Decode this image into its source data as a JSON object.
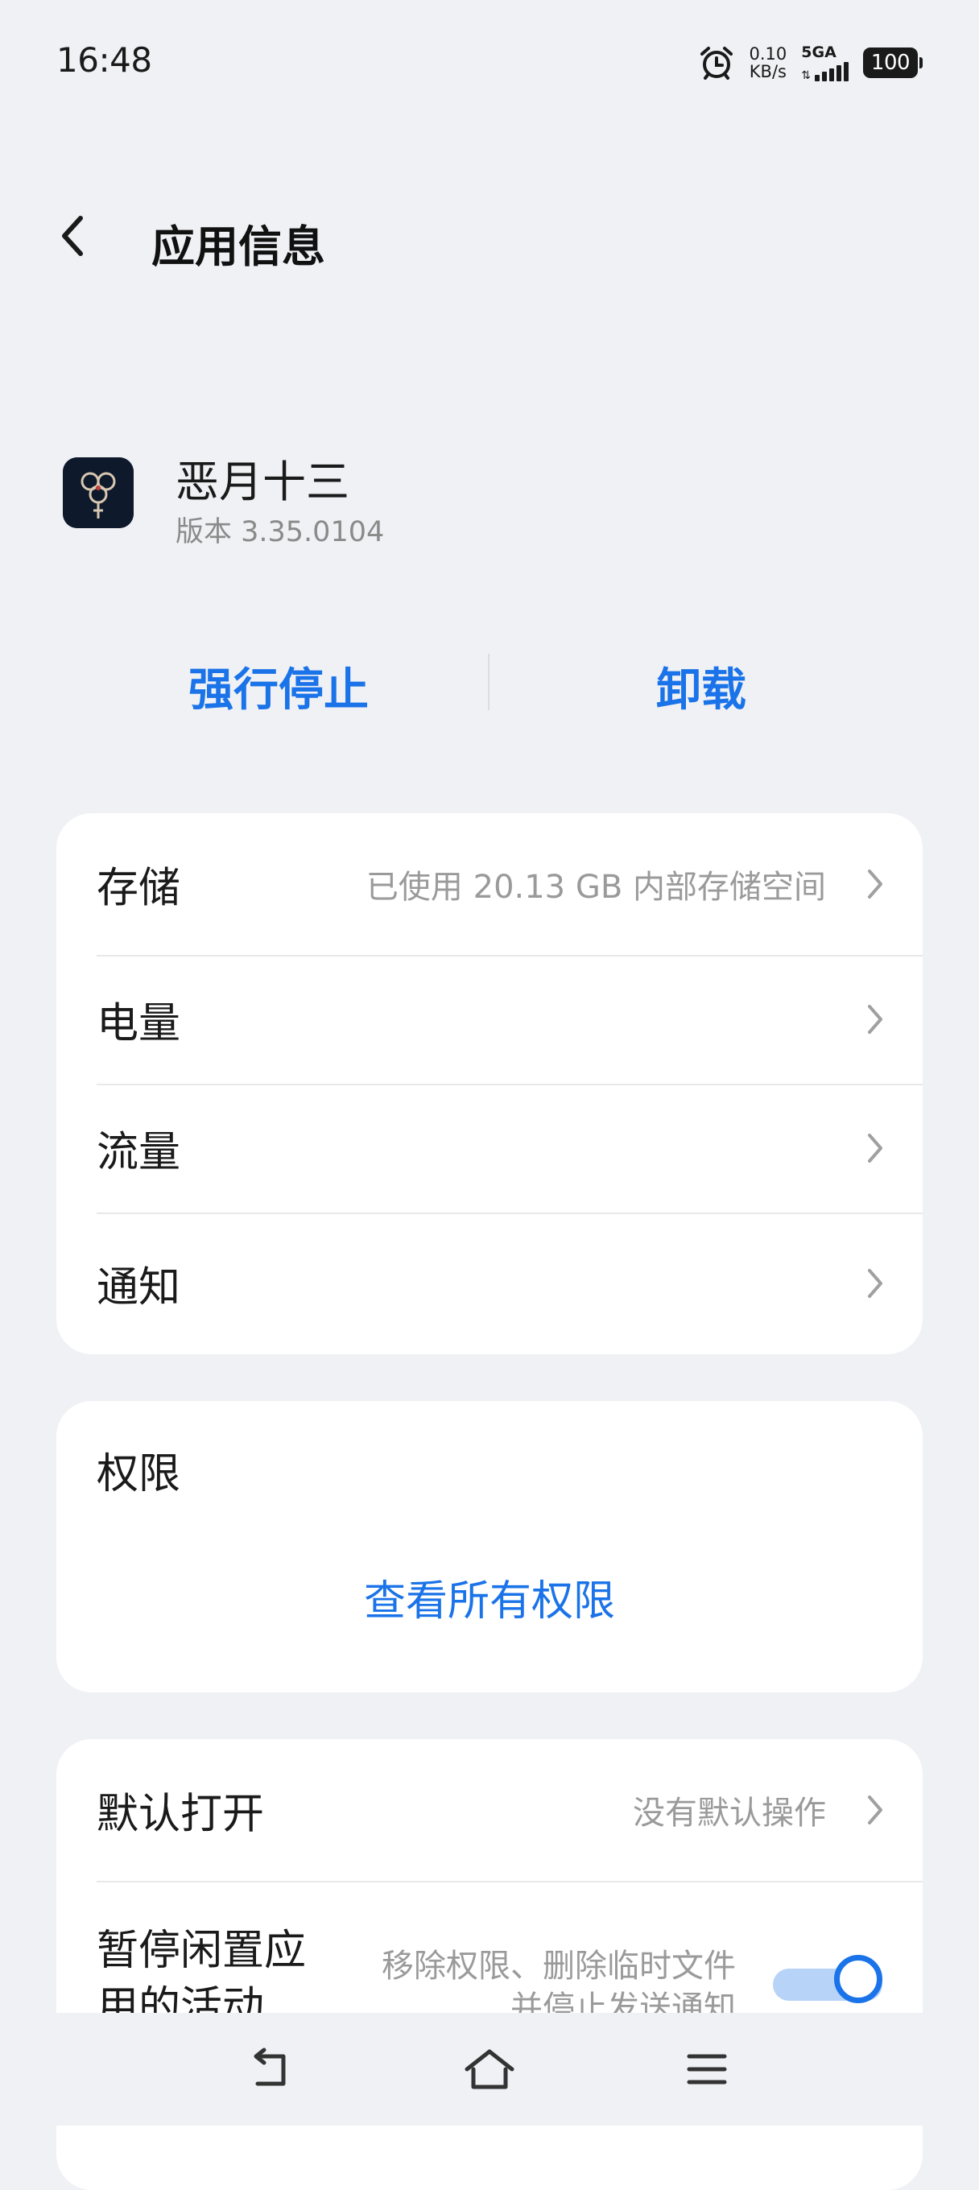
{
  "status_bar": {
    "time": "16:48",
    "net_speed_value": "0.10",
    "net_speed_unit": "KB/s",
    "network_type": "5GA",
    "battery": "100",
    "icons": [
      "alarm-clock-icon",
      "signal-strength-icon",
      "battery-icon"
    ]
  },
  "header": {
    "back_icon": "chevron-left-icon",
    "title": "应用信息"
  },
  "app": {
    "name": "恶月十三",
    "version": "版本 3.35.0104"
  },
  "actions": {
    "force_stop": "强行停止",
    "uninstall": "卸载"
  },
  "settings_group": {
    "items": [
      {
        "label": "存储",
        "value": "已使用 20.13 GB 内部存储空间"
      },
      {
        "label": "电量",
        "value": ""
      },
      {
        "label": "流量",
        "value": ""
      },
      {
        "label": "通知",
        "value": ""
      }
    ]
  },
  "permissions": {
    "title": "权限",
    "view_all": "查看所有权限"
  },
  "defaults_group": {
    "default_open_label": "默认打开",
    "default_open_value": "没有默认操作",
    "pause_label": "暂停闲置应用的活动",
    "pause_desc": "移除权限、删除临时文件并停止发送通知",
    "pause_enabled": true
  },
  "colors": {
    "accent": "#1a73e8",
    "background": "#f0f1f5",
    "card": "#ffffff",
    "secondary_text": "#9a9a9a"
  },
  "nav_bar": {
    "icons": [
      "back-icon",
      "home-icon",
      "menu-icon"
    ]
  }
}
